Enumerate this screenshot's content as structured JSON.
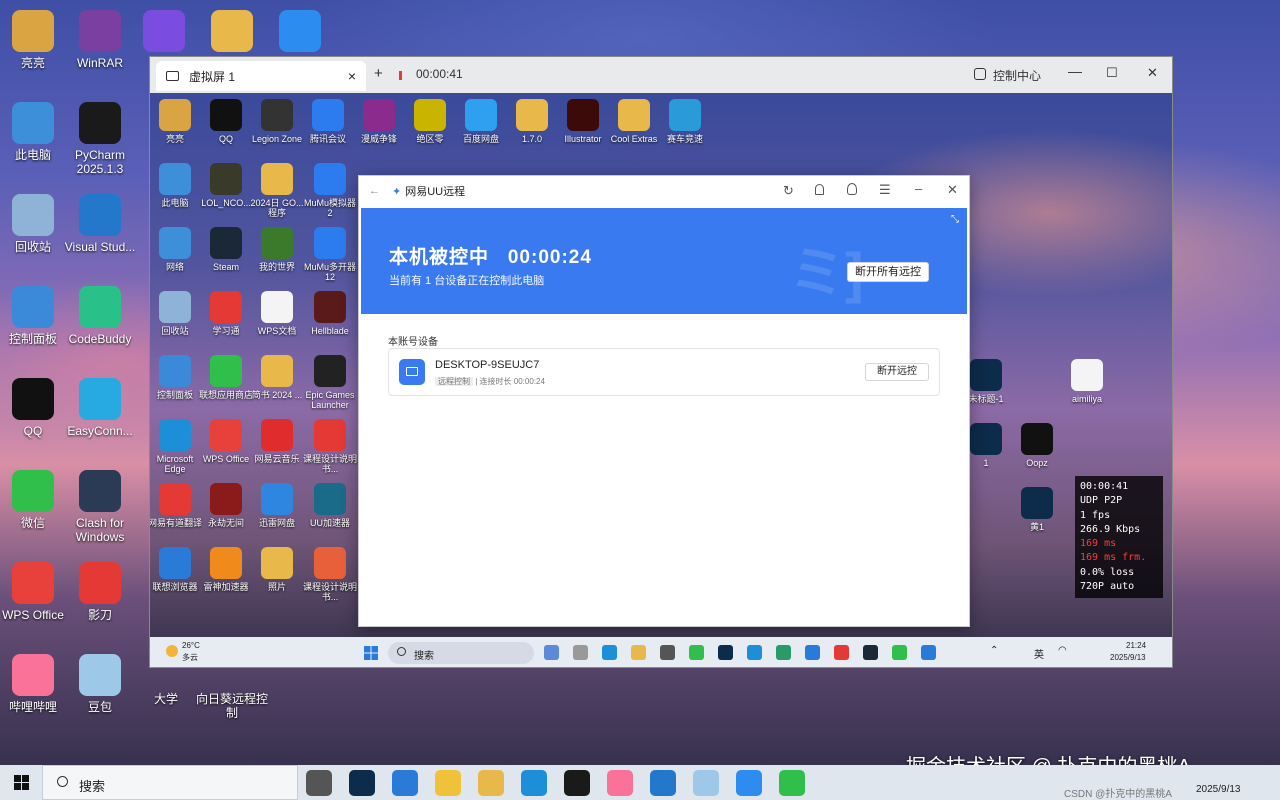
{
  "desktop_icons": [
    {
      "label": "亮亮",
      "icon": "user-folder-icon",
      "color": "#d9a441"
    },
    {
      "label": "WinRAR",
      "icon": "winrar-icon",
      "color": "#7a3fa0"
    },
    {
      "label": "",
      "icon": "purple-app-icon",
      "color": "#7b4ce0"
    },
    {
      "label": "",
      "icon": "folder-icon",
      "color": "#e8b84a"
    },
    {
      "label": "",
      "icon": "todesk-icon",
      "color": "#2d8cf0"
    },
    {
      "label": "此电脑",
      "icon": "computer-icon",
      "color": "#3c8fd8"
    },
    {
      "label": "PyCharm 2025.1.3",
      "icon": "pycharm-icon",
      "color": "#1a1a1a"
    },
    {
      "label": "回收站",
      "icon": "recycle-bin-icon",
      "color": "#8fb3d6"
    },
    {
      "label": "Visual Stud...",
      "icon": "vscode-icon",
      "color": "#2478cc"
    },
    {
      "label": "控制面板",
      "icon": "control-panel-icon",
      "color": "#3b8ad9"
    },
    {
      "label": "CodeBuddy",
      "icon": "codebuddy-icon",
      "color": "#29c08a"
    },
    {
      "label": "QQ",
      "icon": "qq-icon",
      "color": "#111111"
    },
    {
      "label": "EasyConn...",
      "icon": "easyconnect-icon",
      "color": "#27a9e1"
    },
    {
      "label": "微信",
      "icon": "wechat-icon",
      "color": "#2fbf4a"
    },
    {
      "label": "Clash for Windows",
      "icon": "clash-icon",
      "color": "#2b3a55"
    },
    {
      "label": "WPS Office",
      "icon": "wps-icon",
      "color": "#e8403a"
    },
    {
      "label": "影刀",
      "icon": "yingdao-icon",
      "color": "#e53935"
    },
    {
      "label": "哔哩哔哩",
      "icon": "bilibili-icon",
      "color": "#fb7299"
    },
    {
      "label": "豆包",
      "icon": "doubao-icon",
      "color": "#9ec8e8"
    },
    {
      "label": "大学",
      "icon": "folder-icon",
      "color": "#e8b84a"
    },
    {
      "label": "向日葵远程控制",
      "icon": "sunflower-icon",
      "color": "#f07a2a"
    }
  ],
  "remote_window": {
    "tab_title": "虚拟屏 1",
    "tab_close": "×",
    "new_tab": "+",
    "timer": "00:00:41",
    "control_center": "控制中心",
    "minimize": "—",
    "maximize": "☐",
    "close": "✕"
  },
  "remote_icons": [
    {
      "label": "亮亮",
      "color": "#d9a441"
    },
    {
      "label": "QQ",
      "color": "#111111"
    },
    {
      "label": "Legion Zone",
      "color": "#333333"
    },
    {
      "label": "腾讯会议",
      "color": "#2c7cf0"
    },
    {
      "label": "漫威争锋",
      "color": "#8b2b8e"
    },
    {
      "label": "绝区零",
      "color": "#c9b400"
    },
    {
      "label": "百度网盘",
      "color": "#2fa0f0"
    },
    {
      "label": "1.7.0",
      "color": "#e8b84a"
    },
    {
      "label": "Illustrator",
      "color": "#3d0a0a"
    },
    {
      "label": "Cool Extras",
      "color": "#e8b84a"
    },
    {
      "label": "赛车竞速",
      "color": "#2a9ad8"
    },
    {
      "label": "此电脑",
      "color": "#3c8fd8"
    },
    {
      "label": "LOL_NCO...",
      "color": "#3a3a2a"
    },
    {
      "label": "2024日 GO... 程序",
      "color": "#e8b84a"
    },
    {
      "label": "MuMu模拟器 2",
      "color": "#2c7cf0"
    },
    {
      "label": "网络",
      "color": "#3c8fd8"
    },
    {
      "label": "Steam",
      "color": "#1b2838"
    },
    {
      "label": "我的世界",
      "color": "#3a7a2a"
    },
    {
      "label": "MuMu多开器 12",
      "color": "#2c7cf0"
    },
    {
      "label": "回收站",
      "color": "#8fb3d6"
    },
    {
      "label": "学习通",
      "color": "#e53935"
    },
    {
      "label": "WPS文档",
      "color": "#f4f4f4"
    },
    {
      "label": "Hellblade",
      "color": "#5a1a1a"
    },
    {
      "label": "控制面板",
      "color": "#3b8ad9"
    },
    {
      "label": "联想应用商店",
      "color": "#2fbf4a"
    },
    {
      "label": "简书 2024 ...",
      "color": "#e8b84a"
    },
    {
      "label": "Epic Games Launcher",
      "color": "#222222"
    },
    {
      "label": "Microsoft Edge",
      "color": "#1d8fd8"
    },
    {
      "label": "WPS Office",
      "color": "#e8403a"
    },
    {
      "label": "网易云音乐",
      "color": "#e02c2c"
    },
    {
      "label": "课程设计说明书...",
      "color": "#e53935"
    },
    {
      "label": "网易有道翻译",
      "color": "#e53935"
    },
    {
      "label": "永劫无间",
      "color": "#8b1a1a"
    },
    {
      "label": "迅雷网盘",
      "color": "#2f86e0"
    },
    {
      "label": "UU加速器",
      "color": "#1a6a8a"
    },
    {
      "label": "联想浏览器",
      "color": "#2a7ad8"
    },
    {
      "label": "雷神加速器",
      "color": "#f08a1a"
    },
    {
      "label": "照片",
      "color": "#e8b84a"
    },
    {
      "label": "课程设计说明书...",
      "color": "#e8603a"
    },
    {
      "label": "未标题-1",
      "color": "#0d2b4a"
    },
    {
      "label": "aimiliya",
      "color": "#f4f4f4"
    },
    {
      "label": "1",
      "color": "#0d2b4a"
    },
    {
      "label": "Oopz",
      "color": "#111111"
    },
    {
      "label": "黄1",
      "color": "#0d2b4a"
    }
  ],
  "uu": {
    "title": "网易UU远程",
    "status": "本机被控中",
    "elapsed": "00:00:24",
    "subtitle": "当前有 1 台设备正在控制此电脑",
    "disconnect_all": "断开所有远控",
    "section": "本账号设备",
    "device_name": "DESKTOP-9SEUJC7",
    "device_tag": "远程控制",
    "device_duration": "连接时长 00:00:24",
    "disconnect": "断开远控",
    "accent": "#3a7af0"
  },
  "remote_taskbar": {
    "weather_temp": "26°C",
    "weather_desc": "多云",
    "search": "搜索",
    "ime": "英",
    "time": "21:24",
    "date": "2025/9/13"
  },
  "stats": [
    "00:00:41",
    "UDP P2P",
    "1 fps",
    "266.9 Kbps",
    "169 ms",
    "169 ms frm.",
    "0.0% loss",
    "720P auto"
  ],
  "stats_alert_color": "#ff3b3b",
  "main_taskbar": {
    "search": "搜索",
    "date": "2025/9/13",
    "watermark": "掘金技术社区 @ 扑克中的黑桃A",
    "csdn": "CSDN @扑克中的黑桃A"
  }
}
